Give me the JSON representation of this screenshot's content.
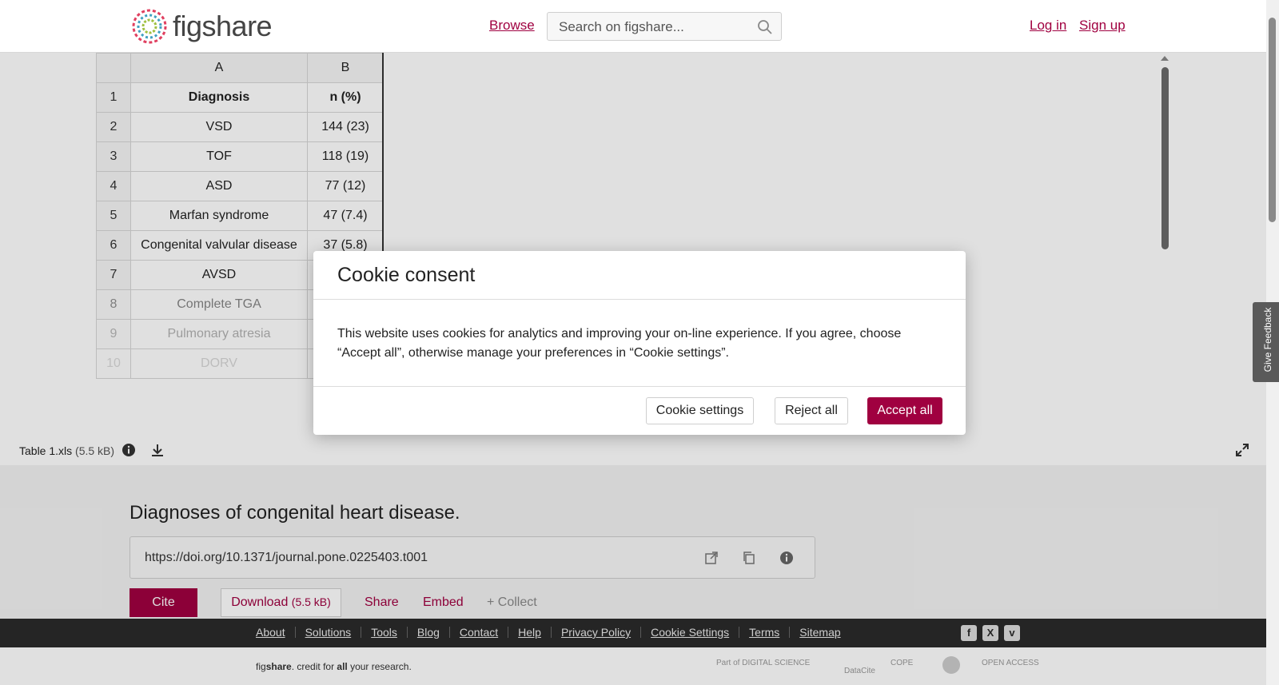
{
  "header": {
    "logo_text": "figshare",
    "browse": "Browse",
    "search_placeholder": "Search on figshare...",
    "login": "Log in",
    "signup": "Sign up"
  },
  "sheet": {
    "col_headers": [
      "A",
      "B"
    ],
    "rows": [
      {
        "n": "1",
        "a": "Diagnosis",
        "b": "n (%)"
      },
      {
        "n": "2",
        "a": "VSD",
        "b": "144 (23)"
      },
      {
        "n": "3",
        "a": "TOF",
        "b": "118 (19)"
      },
      {
        "n": "4",
        "a": "ASD",
        "b": "77 (12)"
      },
      {
        "n": "5",
        "a": "Marfan syndrome",
        "b": "47 (7.4)"
      },
      {
        "n": "6",
        "a": "Congenital valvular disease",
        "b": "37 (5.8)"
      },
      {
        "n": "7",
        "a": "AVSD",
        "b": ""
      },
      {
        "n": "8",
        "a": "Complete TGA",
        "b": ""
      },
      {
        "n": "9",
        "a": "Pulmonary atresia",
        "b": ""
      },
      {
        "n": "10",
        "a": "DORV",
        "b": ""
      }
    ]
  },
  "file": {
    "name": "Table 1.xls",
    "size": "(5.5 kB)"
  },
  "item": {
    "title": "Diagnoses of congenital heart disease.",
    "doi": "https://doi.org/10.1371/journal.pone.0225403.t001",
    "cite": "Cite",
    "download": "Download",
    "download_size": "(5.5 kB)",
    "share": "Share",
    "embed": "Embed",
    "collect": "+ Collect"
  },
  "footer": {
    "links": [
      "About",
      "Solutions",
      "Tools",
      "Blog",
      "Contact",
      "Help",
      "Privacy Policy",
      "Cookie Settings",
      "Terms",
      "Sitemap"
    ],
    "tagline_pre": "fig",
    "tagline_bold": "share",
    "tagline_mid": ". credit for ",
    "tagline_all": "all",
    "tagline_post": " your research.",
    "partners": [
      "Part of DIGITAL SCIENCE",
      "DataCite",
      "COPE",
      "",
      "OPEN ACCESS"
    ]
  },
  "feedback": "Give Feedback",
  "modal": {
    "title": "Cookie consent",
    "body": "This website uses cookies for analytics and improving your on-line experience. If you agree, choose “Accept all”, otherwise manage your preferences in “Cookie settings”.",
    "settings": "Cookie settings",
    "reject": "Reject all",
    "accept": "Accept all"
  },
  "colors": {
    "accent": "#a00040",
    "footer_bg": "#2b2b2b"
  }
}
